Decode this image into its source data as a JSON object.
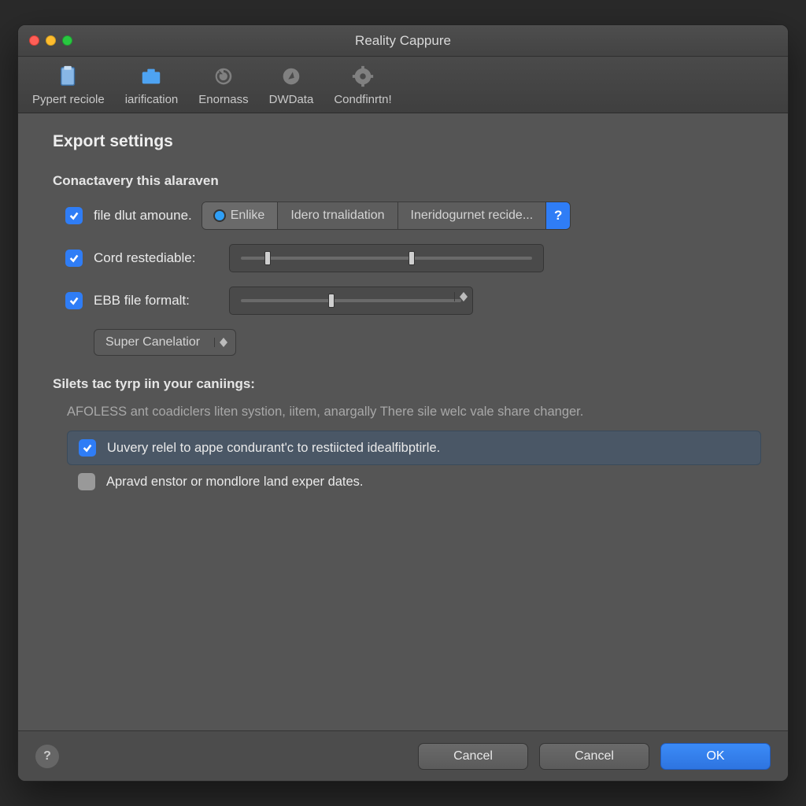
{
  "window": {
    "title": "Reality Cappure"
  },
  "toolbar": {
    "items": [
      {
        "label": "Pypert reciole"
      },
      {
        "label": "iarification"
      },
      {
        "label": "Enornass"
      },
      {
        "label": "DWData"
      },
      {
        "label": "Condfinrtn!"
      }
    ]
  },
  "page": {
    "title": "Export settings"
  },
  "section1": {
    "heading": "Conactavery this alaraven",
    "file_dlut_label": "file dlut amoune.",
    "seg": {
      "opt1": "Enlike",
      "opt2": "Idero trnalidation",
      "opt3": "Ineridogurnet recide...",
      "help": "?"
    },
    "cord_label": "Cord restediable:",
    "ebb_label": "EBB file formalt:",
    "dropdown1": {
      "label": "Super Canelatior"
    }
  },
  "section2": {
    "heading": "Silets tac tyrp iin your caniings:",
    "desc": "AFOLESS ant coadiclers liten systion, iitem, anargally There sile welc vale share changer.",
    "opt1": "Uuvery relel to appe condurant'c to restiicted idealfibptirle.",
    "opt2": "Apravd enstor or mondlore land exper dates."
  },
  "footer": {
    "help": "?",
    "cancel1": "Cancel",
    "cancel2": "Cancel",
    "ok": "OK"
  }
}
